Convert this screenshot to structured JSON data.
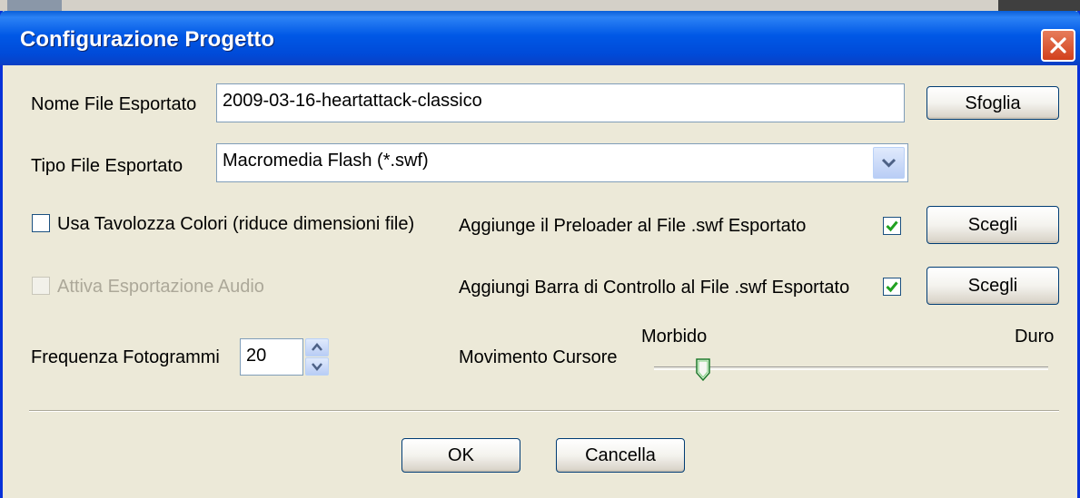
{
  "window": {
    "title": "Configurazione Progetto"
  },
  "form": {
    "nome_label": "Nome File Esportato",
    "nome_value": "2009-03-16-heartattack-classico",
    "sfoglia_label": "Sfoglia",
    "tipo_label": "Tipo File Esportato",
    "tipo_value": "Macromedia Flash (*.swf)",
    "tavolozza_label": "Usa Tavolozza Colori (riduce dimensioni file)",
    "tavolozza_checked": false,
    "audio_label": "Attiva Esportazione Audio",
    "audio_checked": false,
    "audio_enabled": false,
    "preloader_label": "Aggiunge il Preloader al File .swf Esportato",
    "preloader_checked": true,
    "preloader_button": "Scegli",
    "barra_label": "Aggiungi Barra di Controllo al File .swf Esportato",
    "barra_checked": true,
    "barra_button": "Scegli",
    "frequenza_label": "Frequenza Fotogrammi",
    "frequenza_value": "20",
    "cursore_label": "Movimento Cursore",
    "slider_min_label": "Morbido",
    "slider_max_label": "Duro",
    "slider_value": 0.11
  },
  "footer": {
    "ok_label": "OK",
    "cancel_label": "Cancella"
  },
  "colors": {
    "title_bar": "#0058e6",
    "close_button": "#d2401c",
    "check_mark": "#21a121",
    "window_bg": "#ece9d8"
  },
  "icons": {
    "close": "close-icon",
    "dropdown": "chevron-down-icon",
    "spin_up": "spin-up-icon",
    "spin_down": "spin-down-icon",
    "check": "check-icon"
  }
}
